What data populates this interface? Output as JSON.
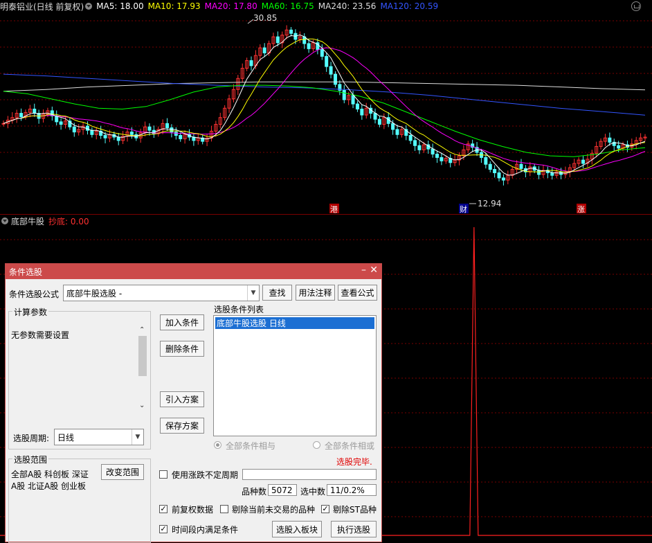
{
  "chart_header": {
    "stock": "明泰铝业(日线 前复权)",
    "ma5": {
      "label": "MA5: 18.00",
      "color": "#ffffff"
    },
    "ma10": {
      "label": "MA10: 17.93",
      "color": "#ffff00"
    },
    "ma20": {
      "label": "MA20: 17.80",
      "color": "#ff00ff"
    },
    "ma60": {
      "label": "MA60: 16.75",
      "color": "#00ff00"
    },
    "ma240": {
      "label": "MA240: 23.56",
      "color": "#dddddd"
    },
    "ma120": {
      "label": "MA120: 20.59",
      "color": "#3355ff"
    }
  },
  "chart_annotations": {
    "high": "30.85",
    "low": "12.94",
    "markers": [
      "港",
      "财",
      "涨"
    ]
  },
  "indicator": {
    "name": "底部牛股",
    "signal": "抄底: 0.00"
  },
  "chart_data": {
    "type": "line",
    "price_range": [
      10.5,
      32.5
    ],
    "candles_close": [
      19.6,
      20.0,
      20.3,
      20.8,
      20.4,
      20.9,
      21.3,
      20.8,
      20.2,
      20.7,
      21.1,
      20.5,
      19.8,
      19.5,
      19.9,
      19.2,
      18.6,
      18.9,
      19.3,
      18.8,
      18.3,
      18.7,
      18.2,
      17.9,
      18.3,
      18.0,
      17.6,
      18.1,
      18.6,
      18.3,
      17.9,
      18.5,
      19.2,
      18.8,
      18.4,
      18.9,
      19.6,
      19.1,
      18.6,
      18.2,
      17.8,
      18.3,
      18.0,
      17.6,
      17.9,
      17.5,
      17.9,
      18.7,
      19.5,
      20.3,
      21.4,
      22.5,
      23.6,
      24.9,
      26.1,
      27.0,
      26.4,
      27.6,
      28.5,
      27.9,
      29.0,
      29.8,
      29.1,
      30.0,
      30.6,
      30.2,
      29.5,
      29.8,
      29.0,
      28.4,
      29.1,
      28.3,
      27.5,
      26.3,
      25.4,
      24.2,
      23.5,
      22.4,
      22.9,
      21.9,
      21.3,
      20.6,
      21.4,
      20.8,
      20.1,
      19.5,
      20.3,
      19.6,
      18.9,
      18.3,
      18.9,
      18.2,
      17.6,
      17.0,
      16.5,
      17.1,
      16.6,
      16.0,
      15.6,
      15.2,
      15.5,
      15.0,
      15.3,
      15.8,
      16.5,
      17.2,
      16.8,
      16.2,
      15.6,
      14.8,
      14.2,
      13.8,
      13.2,
      12.94,
      13.5,
      14.2,
      14.8,
      14.3,
      13.9,
      14.5,
      14.1,
      13.6,
      14.1,
      13.8,
      13.5,
      13.9,
      13.6,
      13.9,
      14.4,
      14.9,
      15.3,
      14.9,
      15.4,
      16.1,
      16.9,
      17.5,
      17.9,
      17.4,
      17.0,
      16.7,
      17.1,
      16.8,
      17.2,
      17.6,
      17.9,
      18.0
    ],
    "ma240": [
      23.4,
      23.6,
      23.9,
      24.1,
      24.3,
      24.4,
      24.5,
      24.5,
      24.5,
      24.4,
      24.3,
      24.2,
      24.1,
      23.9,
      23.7,
      23.56
    ],
    "ma120": [
      25.4,
      25.2,
      24.9,
      24.6,
      24.3,
      24.1,
      23.9,
      23.8,
      23.6,
      23.3,
      22.9,
      22.4,
      21.9,
      21.4,
      21.0,
      20.59
    ],
    "ma60": [
      23.4,
      23.1,
      22.5,
      21.9,
      21.4,
      21.3,
      21.6,
      22.4,
      23.3,
      23.9,
      24.1,
      24.1,
      24.0,
      23.8,
      23.4,
      22.8,
      22.0,
      20.9,
      19.8,
      18.7,
      17.7,
      16.9,
      16.2,
      15.8,
      15.7,
      16.0,
      16.5,
      16.75
    ],
    "signal_values": [
      {
        "x": 0.727,
        "value": 1
      }
    ]
  },
  "dialog": {
    "title": "条件选股",
    "formula_label": "条件选股公式",
    "formula_value": "底部牛股选股 -",
    "btn_find": "查找",
    "btn_usage": "用法注释",
    "btn_view": "查看公式",
    "params_group": "计算参数",
    "params_text": "无参数需要设置",
    "period_label": "选股周期:",
    "period_value": "日线",
    "btn_add": "加入条件",
    "btn_delete": "删除条件",
    "btn_import": "引入方案",
    "btn_save": "保存方案",
    "list_title": "选股条件列表",
    "list_items": [
      "底部牛股选股  日线"
    ],
    "radio_and": "全部条件相与",
    "radio_or": "全部条件相或",
    "status": "选股完毕.",
    "range_group": "选股范围",
    "range_text_1": "全部A股 科创板 深证",
    "range_text_2": "A股 北证A股 创业板",
    "btn_range": "改变范围",
    "chk_variable_period": "使用涨跌不定周期",
    "count_label": "品种数",
    "count_value": "5072",
    "selected_label": "选中数",
    "selected_value": "11/0.2%",
    "chk_adjusted": "前复权数据",
    "chk_remove_untraded": "剔除当前未交易的品种",
    "chk_remove_st": "剔除ST品种",
    "chk_time_range": "时间段内满足条件",
    "btn_to_block": "选股入板块",
    "btn_execute": "执行选股"
  }
}
